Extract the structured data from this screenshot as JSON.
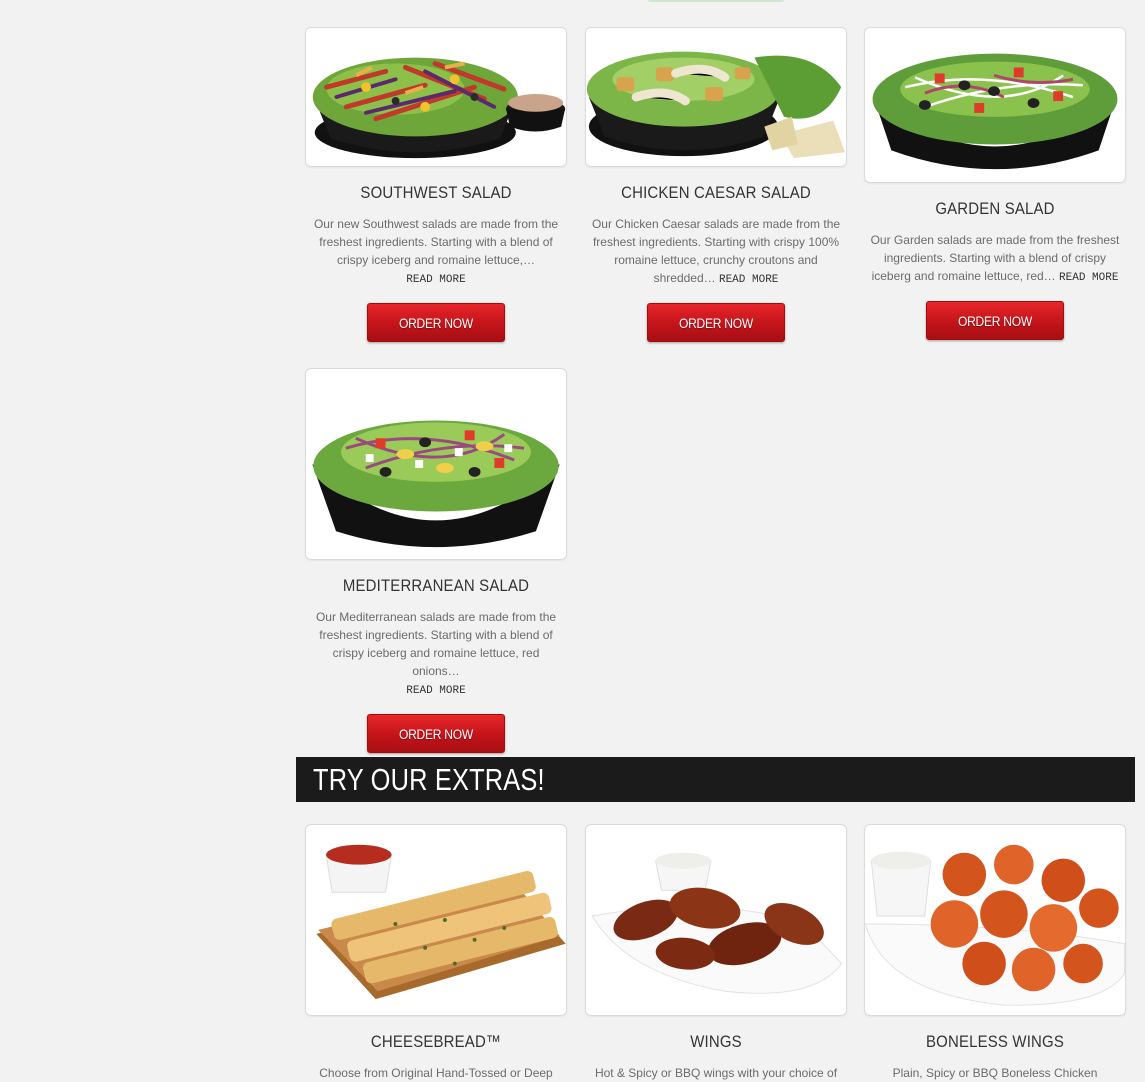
{
  "salads": [
    {
      "title": "Southwest Salad",
      "desc": "Our new Southwest salads are made from the freshest ingredients. Starting with a blend of crispy iceberg and romaine lettuce,…",
      "read_more": "Read More",
      "button": "Order Now",
      "image_icon": "southwest-salad-photo"
    },
    {
      "title": "Chicken Caesar Salad",
      "desc": "Our Chicken Caesar salads are made from the freshest ingredients. Starting with crispy 100% romaine lettuce, crunchy croutons and shredded…",
      "read_more": "Read More",
      "button": "Order Now",
      "image_icon": "chicken-caesar-salad-photo"
    },
    {
      "title": "Garden Salad",
      "desc": "Our Garden salads are made from the freshest ingredients. Starting with a blend of crispy iceberg and romaine lettuce, red…",
      "read_more": "Read More",
      "button": "Order Now",
      "image_icon": "garden-salad-photo"
    },
    {
      "title": "Mediterranean Salad",
      "desc": "Our Mediterranean salads are made from the freshest ingredients. Starting with a blend of crispy iceberg and romaine lettuce, red onions…",
      "read_more": "Read More",
      "button": "Order Now",
      "image_icon": "mediterranean-salad-photo"
    }
  ],
  "extras_heading": "Try Our Extras!",
  "extras": [
    {
      "title": "Cheesebread™",
      "desc": "Choose from Original Hand-Tossed or Deep",
      "image_icon": "cheesebread-photo"
    },
    {
      "title": "Wings",
      "desc": "Hot & Spicy or BBQ wings with your choice of",
      "image_icon": "wings-photo"
    },
    {
      "title": "Boneless Wings",
      "desc": "Plain, Spicy or BBQ Boneless Chicken",
      "image_icon": "boneless-wings-photo"
    }
  ],
  "colors": {
    "page_bg": "#f2f2f2",
    "button_red": "#c2141a",
    "section_bar": "#1b1b1b",
    "title_text": "#333333",
    "desc_text": "#6b6b6b"
  }
}
